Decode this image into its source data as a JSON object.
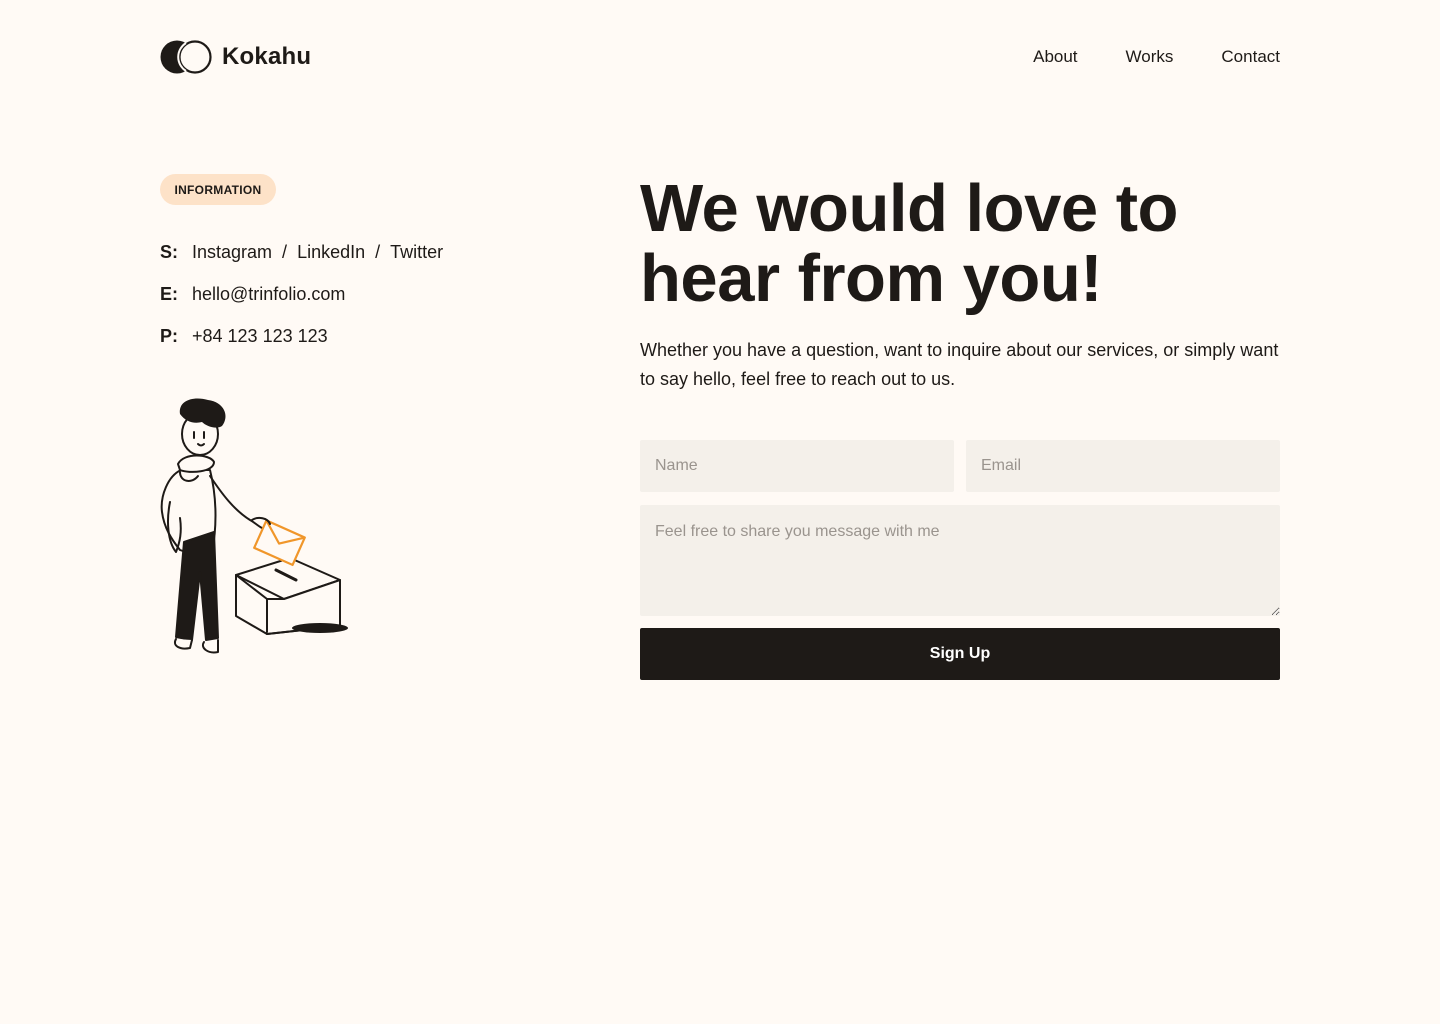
{
  "brand": {
    "name": "Kokahu",
    "logo_icon": "overlapping-circles-logo"
  },
  "nav": {
    "about": "About",
    "works": "Works",
    "contact": "Contact"
  },
  "info": {
    "badge": "INFORMATION",
    "social": {
      "key": "S:",
      "instagram": "Instagram",
      "linkedin": "LinkedIn",
      "twitter": "Twitter",
      "separator": "/"
    },
    "email": {
      "key": "E:",
      "value": "hello@trinfolio.com"
    },
    "phone": {
      "key": "P:",
      "value": "+84 123 123 123"
    }
  },
  "hero": {
    "heading_line1": "We would love to",
    "heading_line2": "hear from you!",
    "subtext": "Whether you have a question, want to inquire about our services, or simply want to say hello, feel free to reach out to us."
  },
  "form": {
    "name_placeholder": "Name",
    "email_placeholder": "Email",
    "message_placeholder": "Feel free to share you message with me",
    "submit_label": "Sign Up"
  },
  "colors": {
    "background": "#FFFAF5",
    "text": "#1E1A17",
    "badge_bg": "#FDE2C8",
    "field_bg": "#F4F0EA",
    "accent_orange": "#F0962A"
  }
}
